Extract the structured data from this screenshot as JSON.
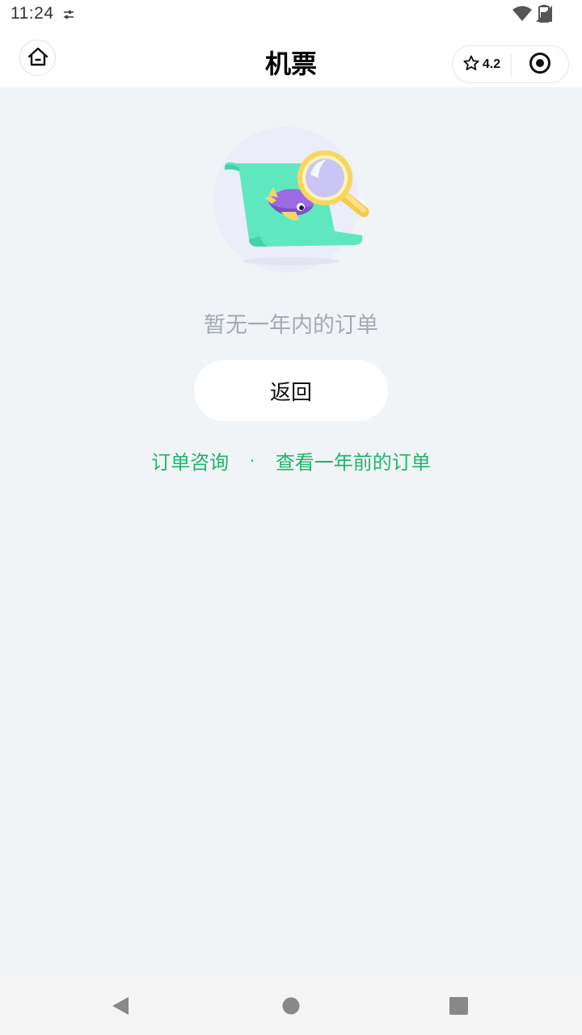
{
  "status_bar": {
    "time": "11:24",
    "icons": [
      "settings-icon",
      "wifi-icon",
      "signal-icon",
      "battery-icon"
    ]
  },
  "nav": {
    "title": "机票",
    "home_icon": "home-icon",
    "rating": "4.2",
    "rating_icon": "star-icon",
    "record_icon": "record-icon"
  },
  "empty_state": {
    "illustration": "airplane-magnifier-illustration",
    "message": "暂无一年内的订单",
    "back_label": "返回"
  },
  "links": {
    "consult": "订单咨询",
    "separator": "·",
    "older_orders": "查看一年前的订单",
    "color": "#1fb56b"
  },
  "system_nav": {
    "icons": [
      "back-triangle-icon",
      "home-circle-icon",
      "recents-square-icon"
    ]
  }
}
